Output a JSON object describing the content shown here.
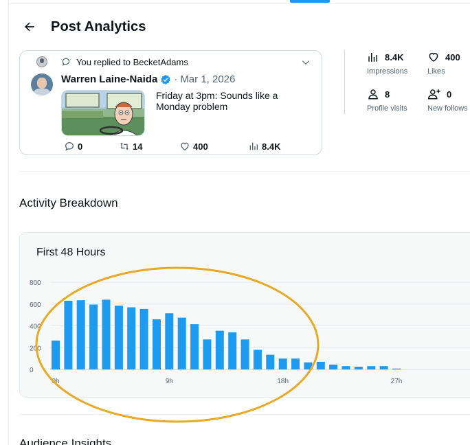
{
  "header": {
    "title": "Post Analytics",
    "back_icon": "arrow-left-icon"
  },
  "post": {
    "reply_context": "You replied to BecketAdams",
    "author_name": "Warren Laine-Naida",
    "verified_icon": "verified-badge-icon",
    "separator": "·",
    "date": "Mar 1, 2026",
    "text": "Friday at 3pm: Sounds like a Monday problem",
    "media": "cartoon-driver-image",
    "actions": {
      "replies": "0",
      "reposts": "14",
      "likes": "400",
      "views": "8.4K"
    }
  },
  "stats": [
    {
      "icon": "bar-chart-icon",
      "value": "8.4K",
      "label": "Impressions"
    },
    {
      "icon": "heart-icon",
      "value": "400",
      "label": "Likes"
    },
    {
      "icon": "person-icon",
      "value": "8",
      "label": "Profile visits"
    },
    {
      "icon": "person-add-icon",
      "value": "0",
      "label": "New follows"
    }
  ],
  "sections": {
    "activity": "Activity Breakdown",
    "audience": "Audience Insights"
  },
  "colors": {
    "accent": "#1d9bf0",
    "annotation": "#e8a924"
  },
  "chart_data": {
    "type": "bar",
    "title": "First 48 Hours",
    "xlabel": "",
    "ylabel": "",
    "ylim": [
      0,
      800
    ],
    "yticks": [
      0,
      200,
      400,
      600,
      800
    ],
    "x_tick_labels": [
      {
        "index": 0,
        "label": "0h"
      },
      {
        "index": 9,
        "label": "9h"
      },
      {
        "index": 18,
        "label": "18h"
      },
      {
        "index": 27,
        "label": "27h"
      }
    ],
    "categories": [
      "0h",
      "1h",
      "2h",
      "3h",
      "4h",
      "5h",
      "6h",
      "7h",
      "8h",
      "9h",
      "10h",
      "11h",
      "12h",
      "13h",
      "14h",
      "15h",
      "16h",
      "17h",
      "18h",
      "19h",
      "20h",
      "21h",
      "22h",
      "23h",
      "24h",
      "25h",
      "26h",
      "27h"
    ],
    "values": [
      265,
      630,
      635,
      595,
      640,
      585,
      570,
      555,
      460,
      515,
      475,
      415,
      275,
      355,
      340,
      275,
      180,
      135,
      100,
      100,
      65,
      70,
      45,
      30,
      25,
      30,
      30,
      8
    ],
    "grid": true
  }
}
